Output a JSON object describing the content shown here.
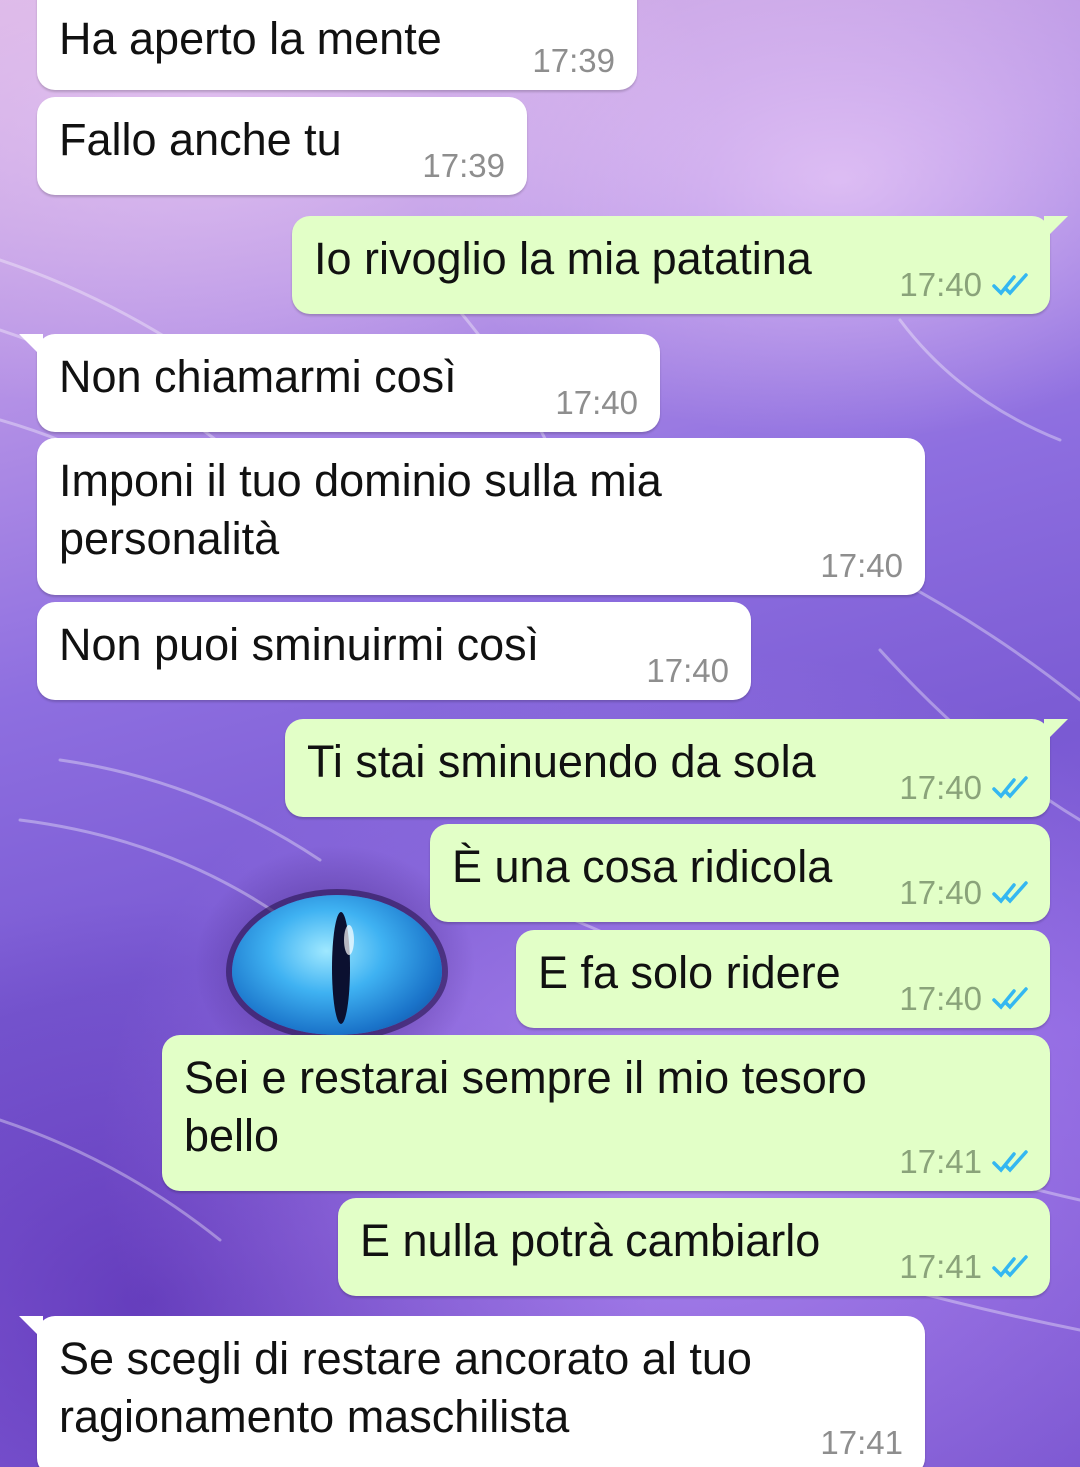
{
  "conversation": {
    "messages": [
      {
        "direction": "in",
        "text": "Ha aperto la mente",
        "time": "17:39"
      },
      {
        "direction": "in",
        "text": "Fallo anche tu",
        "time": "17:39"
      },
      {
        "direction": "out",
        "text": "Io rivoglio la mia patatina",
        "time": "17:40",
        "status": "read"
      },
      {
        "direction": "in",
        "text": "Non chiamarmi così",
        "time": "17:40"
      },
      {
        "direction": "in",
        "text": "Imponi il tuo dominio sulla mia personalità",
        "time": "17:40"
      },
      {
        "direction": "in",
        "text": "Non puoi sminuirmi così",
        "time": "17:40"
      },
      {
        "direction": "out",
        "text": "Ti stai sminuendo da sola",
        "time": "17:40",
        "status": "read"
      },
      {
        "direction": "out",
        "text": "È una cosa ridicola",
        "time": "17:40",
        "status": "read"
      },
      {
        "direction": "out",
        "text": "E fa solo ridere",
        "time": "17:40",
        "status": "read"
      },
      {
        "direction": "out",
        "text": "Sei e restarai sempre il mio tesoro bello",
        "time": "17:41",
        "status": "read"
      },
      {
        "direction": "out",
        "text": "E nulla potrà cambiarlo",
        "time": "17:41",
        "status": "read"
      },
      {
        "direction": "in",
        "text": "Se scegli di restare ancorato al tuo ragionamento maschilista",
        "time": "17:41"
      }
    ]
  },
  "colors": {
    "incoming_bubble": "#ffffff",
    "outgoing_bubble": "#e2ffc7",
    "read_ticks": "#34b7f1",
    "wallpaper_accent": "#8e6fe0"
  },
  "icons": {
    "read_receipt": "double-check-icon",
    "wallpaper": "purple-cat-wallpaper"
  }
}
